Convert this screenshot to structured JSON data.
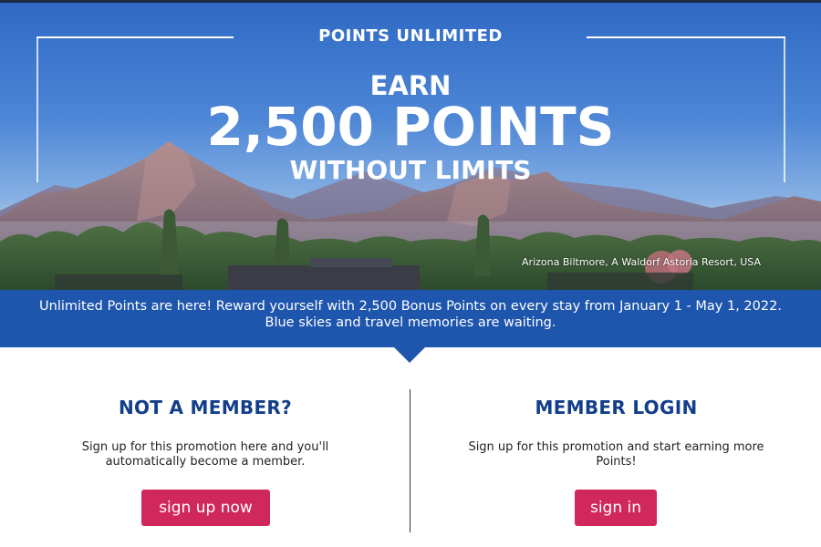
{
  "hero": {
    "eyebrow": "POINTS UNLIMITED",
    "earn": "EARN",
    "points": "2,500 POINTS",
    "without_limits": "WITHOUT LIMITS",
    "caption": "Arizona Biltmore, A Waldorf Astoria Resort, USA"
  },
  "banner": {
    "line1": "Unlimited Points are here! Reward yourself with 2,500 Bonus Points on every stay from January 1 - May 1, 2022.",
    "line2": "Blue skies and travel memories are waiting."
  },
  "not_member": {
    "title": "NOT A MEMBER?",
    "text": "Sign up for this promotion here and you'll automatically become a member.",
    "button": "sign up now"
  },
  "member_login": {
    "title": "MEMBER LOGIN",
    "text": "Sign up for this promotion and start earning more Points!",
    "button": "sign in"
  },
  "colors": {
    "brand_blue": "#1e55ad",
    "title_blue": "#123e8a",
    "cta_pink": "#d0275c"
  }
}
